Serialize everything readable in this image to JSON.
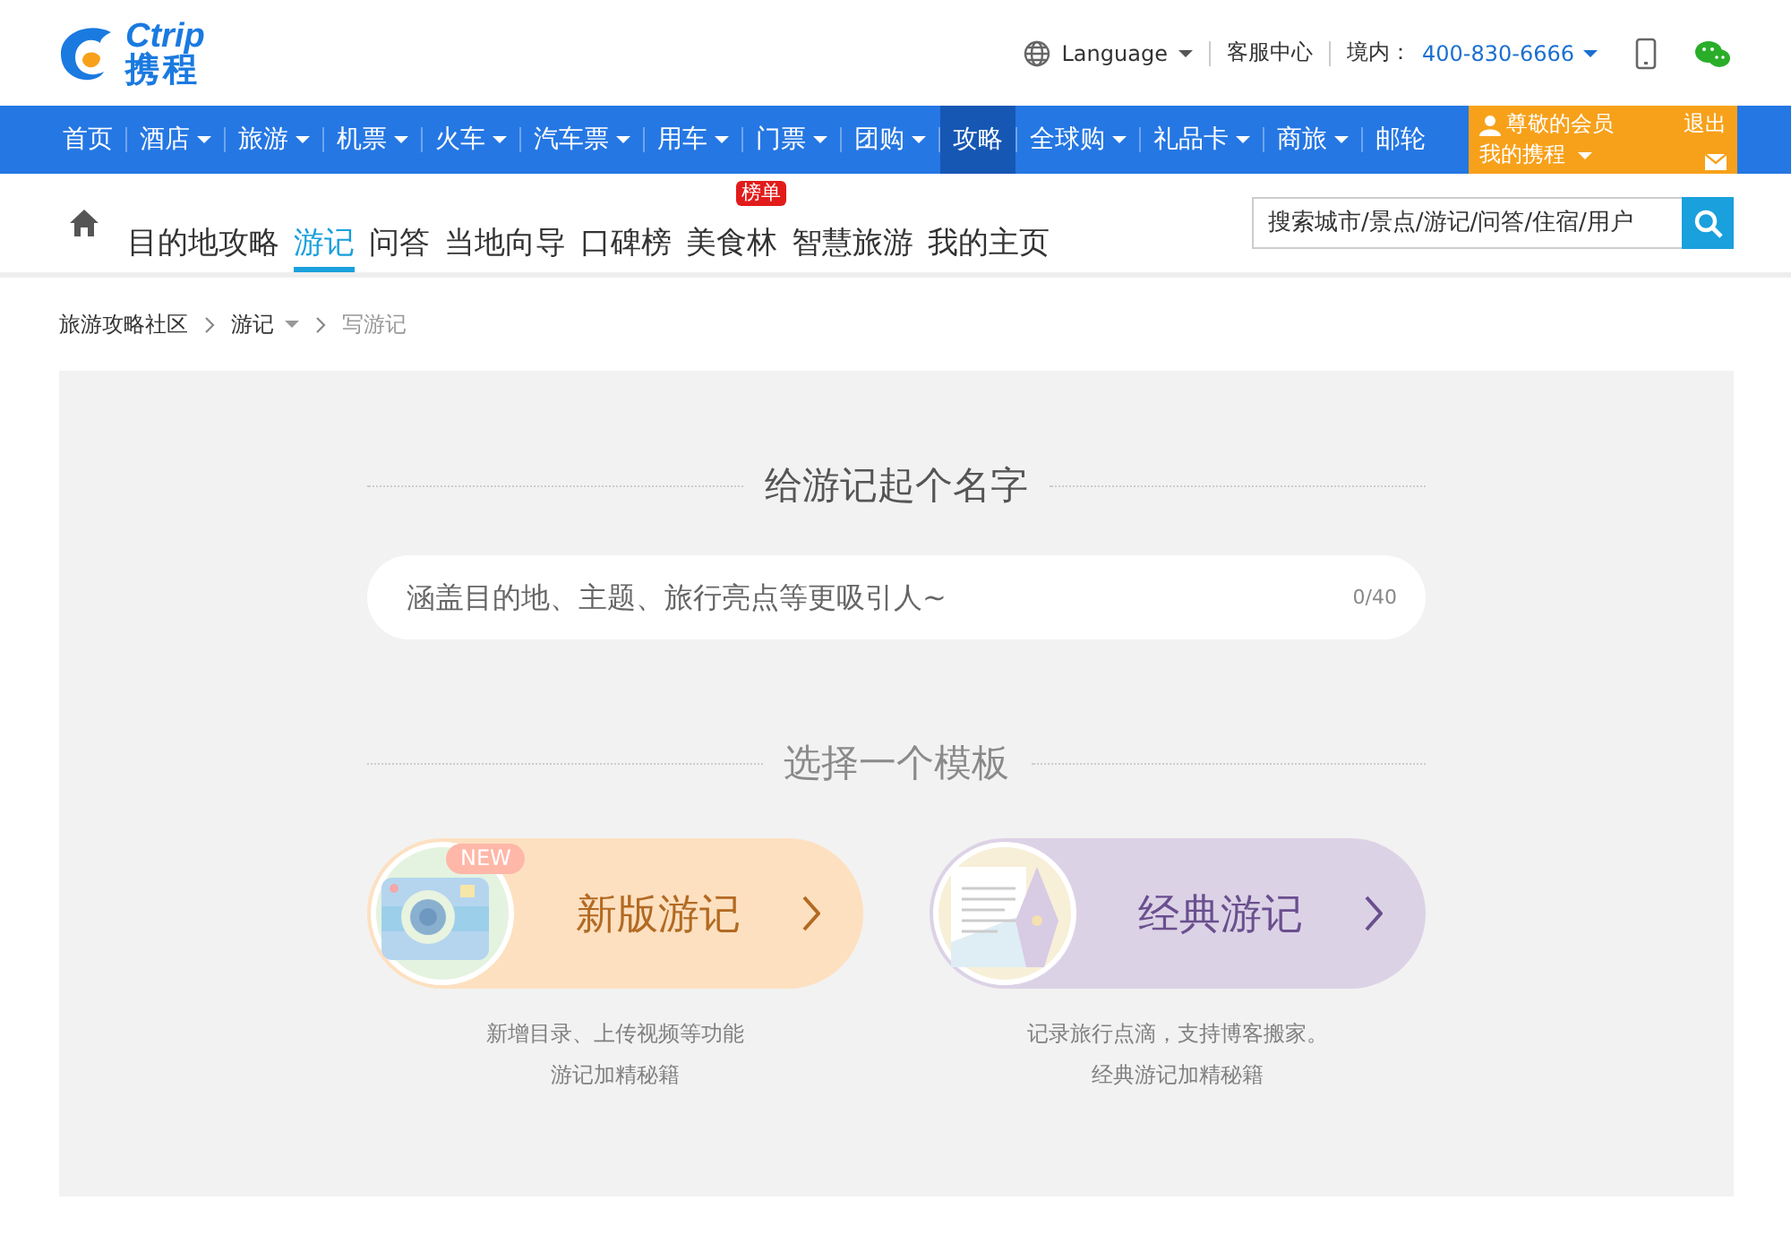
{
  "header": {
    "logo_text": "Ctrip",
    "logo_cn": "携程",
    "language": "Language",
    "service": "客服中心",
    "hotline_label": "境内：",
    "hotline": "400-830-6666"
  },
  "nav": {
    "items": [
      {
        "label": "首页",
        "dropdown": false,
        "selected": false
      },
      {
        "label": "酒店",
        "dropdown": true,
        "selected": false
      },
      {
        "label": "旅游",
        "dropdown": true,
        "selected": false
      },
      {
        "label": "机票",
        "dropdown": true,
        "selected": false
      },
      {
        "label": "火车",
        "dropdown": true,
        "selected": false
      },
      {
        "label": "汽车票",
        "dropdown": true,
        "selected": false
      },
      {
        "label": "用车",
        "dropdown": true,
        "selected": false
      },
      {
        "label": "门票",
        "dropdown": true,
        "selected": false
      },
      {
        "label": "团购",
        "dropdown": true,
        "selected": false
      },
      {
        "label": "攻略",
        "dropdown": false,
        "selected": true
      },
      {
        "label": "全球购",
        "dropdown": true,
        "selected": false
      },
      {
        "label": "礼品卡",
        "dropdown": true,
        "selected": false
      },
      {
        "label": "商旅",
        "dropdown": true,
        "selected": false
      },
      {
        "label": "邮轮",
        "dropdown": false,
        "selected": false
      }
    ],
    "member": {
      "greeting": "尊敬的会员",
      "my_account": "我的携程",
      "logout": "退出"
    }
  },
  "subnav": {
    "items": [
      {
        "label": "目的地攻略",
        "selected": false
      },
      {
        "label": "游记",
        "selected": true
      },
      {
        "label": "问答",
        "selected": false
      },
      {
        "label": "当地向导",
        "selected": false
      },
      {
        "label": "口碑榜",
        "selected": false
      },
      {
        "label": "美食林",
        "selected": false,
        "badge": "榜单"
      },
      {
        "label": "智慧旅游",
        "selected": false
      },
      {
        "label": "我的主页",
        "selected": false
      }
    ],
    "search": {
      "placeholder": "搜索城市/景点/游记/问答/住宿/用户"
    }
  },
  "breadcrumb": {
    "items": [
      {
        "label": "旅游攻略社区",
        "dropdown": false
      },
      {
        "label": "游记",
        "dropdown": true
      }
    ],
    "current": "写游记"
  },
  "title_section": {
    "heading": "给游记起个名字",
    "placeholder": "涵盖目的地、主题、旅行亮点等更吸引人~",
    "counter": "0/40"
  },
  "template_section": {
    "heading": "选择一个模板",
    "templates": [
      {
        "kind": "new",
        "title": "新版游记",
        "badge": "NEW",
        "color": "#fde0c0",
        "lines": [
          "新增目录、上传视频等功能",
          "游记加精秘籍"
        ]
      },
      {
        "kind": "classic",
        "title": "经典游记",
        "color": "#dcd2e6",
        "lines": [
          "记录旅行点滴，支持博客搬家。",
          "经典游记加精秘籍"
        ]
      }
    ]
  }
}
